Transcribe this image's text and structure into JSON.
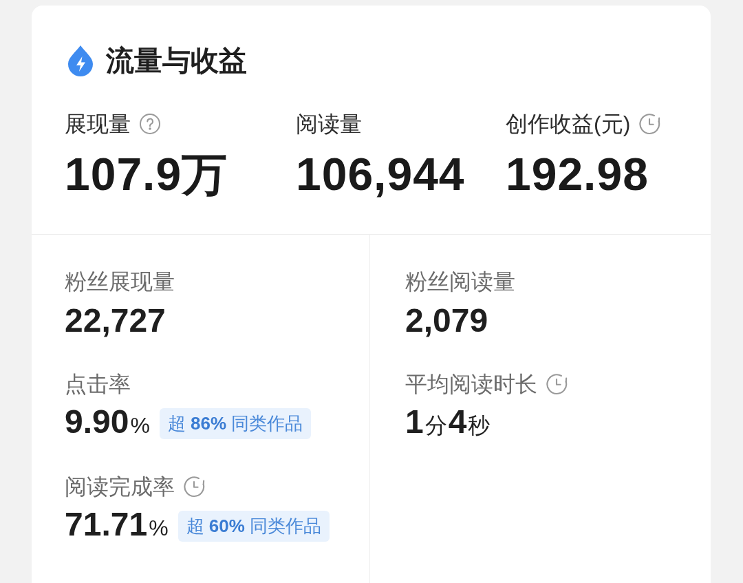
{
  "card": {
    "title": "流量与收益"
  },
  "top_metrics": [
    {
      "label": "展现量",
      "kind": "help",
      "value": "107.9万"
    },
    {
      "label": "阅读量",
      "kind": "plain",
      "value": "106,944"
    },
    {
      "label": "创作收益(元)",
      "kind": "clock",
      "value": "192.98"
    }
  ],
  "detail_columns": [
    {
      "metrics": [
        {
          "label": "粉丝展现量",
          "kind": "plain",
          "value": [
            {
              "text": "22,727",
              "kind": "number"
            }
          ]
        },
        {
          "label": "点击率",
          "kind": "plain",
          "value": [
            {
              "text": "9.90",
              "kind": "number"
            },
            {
              "text": "%",
              "kind": "unit"
            }
          ],
          "comparison": "超 **86%** 同类作品"
        },
        {
          "label": "阅读完成率",
          "kind": "clock",
          "value": [
            {
              "text": "71.71",
              "kind": "number"
            },
            {
              "text": "%",
              "kind": "unit"
            }
          ],
          "comparison": "超 **60%** 同类作品"
        }
      ]
    },
    {
      "metrics": [
        {
          "label": "粉丝阅读量",
          "kind": "plain",
          "value": [
            {
              "text": "2,079",
              "kind": "number"
            }
          ]
        },
        {
          "label": "平均阅读时长",
          "kind": "clock",
          "value": [
            {
              "text": "1",
              "kind": "number"
            },
            {
              "text": "分",
              "kind": "unit"
            },
            {
              "text": "4",
              "kind": "number"
            },
            {
              "text": "秒",
              "kind": "unit"
            }
          ]
        }
      ]
    }
  ]
}
